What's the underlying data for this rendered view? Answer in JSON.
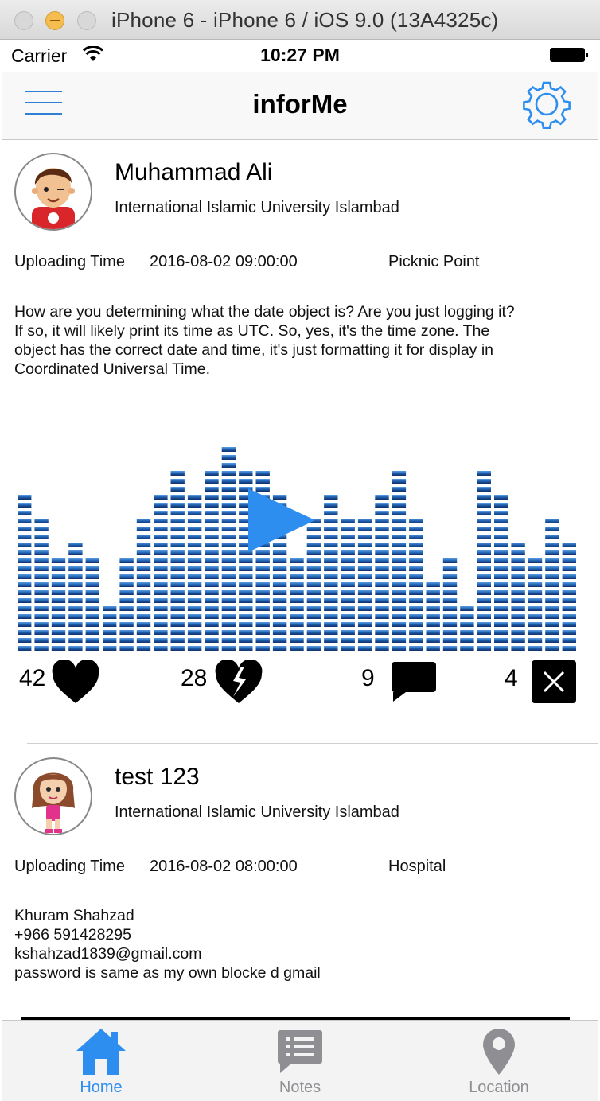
{
  "window": {
    "title": "iPhone 6 - iPhone 6 / iOS 9.0 (13A4325c)"
  },
  "status_bar": {
    "carrier": "Carrier",
    "time": "10:27 PM"
  },
  "nav": {
    "title": "inforMe",
    "left_icon": "hamburger-menu-icon",
    "right_icon": "gear-icon"
  },
  "posts": [
    {
      "name": "Muhammad Ali",
      "university": "International Islamic University Islambad",
      "upload_label": "Uploading Time",
      "upload_time": "2016-08-02 09:00:00",
      "place": "Picknic Point",
      "body": "How are you determining what the date object is? Are you just logging it?\nIf so, it will likely print its time as UTC. So, yes, it's the time zone. The\nobject has the correct date and time, it's just formatting it for display in\nCoordinated Universal Time.",
      "likes": "42",
      "dislikes": "28",
      "comments": "9",
      "reports": "4"
    },
    {
      "name": "test 123",
      "university": "International Islamic University Islambad",
      "upload_label": "Uploading Time",
      "upload_time": "2016-08-02 08:00:00",
      "place": "Hospital",
      "body": "Khuram Shahzad\n+966 591428295\nkshahzad1839@gmail.com\npassword is same as my own blocke d gmail"
    }
  ],
  "tabs": [
    {
      "label": "Home",
      "icon": "home-icon",
      "active": true
    },
    {
      "label": "Notes",
      "icon": "notes-icon",
      "active": false
    },
    {
      "label": "Location",
      "icon": "location-pin-icon",
      "active": false
    }
  ],
  "colors": {
    "accent": "#2e8ef0",
    "inactive": "#8e8e93",
    "equalizer": "#1f5fae"
  }
}
